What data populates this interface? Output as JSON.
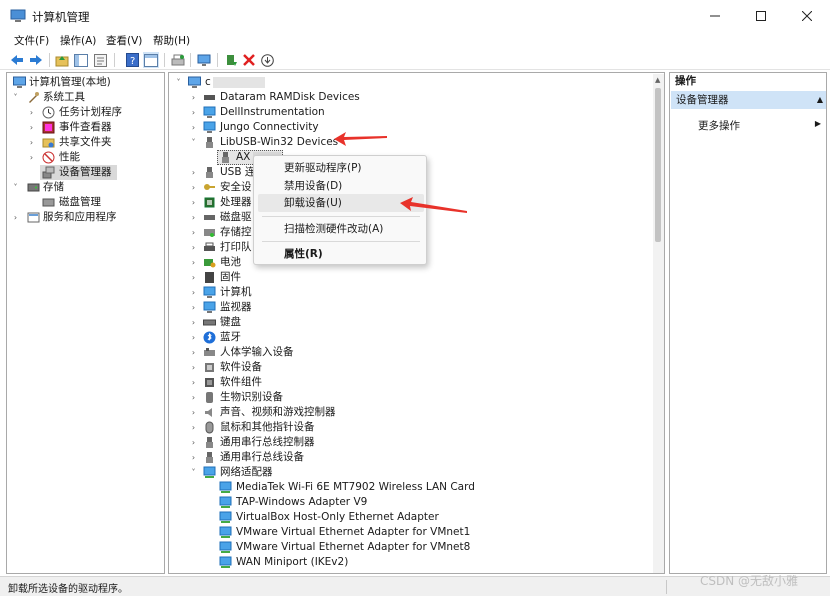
{
  "window": {
    "title": "计算机管理"
  },
  "menu": [
    "文件(F)",
    "操作(A)",
    "查看(V)",
    "帮助(H)"
  ],
  "left_tree": [
    {
      "label": "计算机管理(本地)",
      "icon": "computer-icon"
    },
    {
      "label": "系统工具",
      "icon": "tools-icon"
    },
    {
      "label": "任务计划程序",
      "icon": "clock-icon"
    },
    {
      "label": "事件查看器",
      "icon": "event-viewer-icon"
    },
    {
      "label": "共享文件夹",
      "icon": "shared-folder-icon"
    },
    {
      "label": "性能",
      "icon": "performance-icon"
    },
    {
      "label": "设备管理器",
      "icon": "device-manager-icon"
    },
    {
      "label": "存储",
      "icon": "storage-icon"
    },
    {
      "label": "磁盘管理",
      "icon": "disk-icon"
    },
    {
      "label": "服务和应用程序",
      "icon": "services-icon"
    }
  ],
  "device_tree": {
    "root": "c",
    "items": [
      {
        "label": "Dataram RAMDisk Devices",
        "icon": "ramdisk-icon"
      },
      {
        "label": "DellInstrumentation",
        "icon": "monitor-icon"
      },
      {
        "label": "Jungo Connectivity",
        "icon": "monitor-icon"
      },
      {
        "label": "LibUSB-Win32 Devices",
        "icon": "usb-plug-icon"
      },
      {
        "label": "AX",
        "icon": "usb-plug-icon"
      },
      {
        "label": "USB 连",
        "icon": "usb-plug-icon"
      },
      {
        "label": "安全设",
        "icon": "key-icon"
      },
      {
        "label": "处理器",
        "icon": "processor-icon"
      },
      {
        "label": "磁盘驱",
        "icon": "disk-drive-icon"
      },
      {
        "label": "存储控",
        "icon": "storage-controller-icon"
      },
      {
        "label": "打印队",
        "icon": "printer-icon"
      },
      {
        "label": "电池",
        "icon": "battery-icon"
      },
      {
        "label": "固件",
        "icon": "firmware-icon"
      },
      {
        "label": "计算机",
        "icon": "computer-icon"
      },
      {
        "label": "监视器",
        "icon": "monitor-icon"
      },
      {
        "label": "键盘",
        "icon": "keyboard-icon"
      },
      {
        "label": "蓝牙",
        "icon": "bluetooth-icon"
      },
      {
        "label": "人体学输入设备",
        "icon": "hid-icon"
      },
      {
        "label": "软件设备",
        "icon": "software-device-icon"
      },
      {
        "label": "软件组件",
        "icon": "software-component-icon"
      },
      {
        "label": "生物识别设备",
        "icon": "biometric-icon"
      },
      {
        "label": "声音、视频和游戏控制器",
        "icon": "speaker-icon"
      },
      {
        "label": "鼠标和其他指针设备",
        "icon": "mouse-icon"
      },
      {
        "label": "通用串行总线控制器",
        "icon": "usb-plug-icon"
      },
      {
        "label": "通用串行总线设备",
        "icon": "usb-plug-icon"
      },
      {
        "label": "网络适配器",
        "icon": "network-adapter-icon"
      },
      {
        "label": "MediaTek Wi-Fi 6E MT7902 Wireless LAN Card",
        "icon": "network-adapter-icon"
      },
      {
        "label": "TAP-Windows Adapter V9",
        "icon": "network-adapter-icon"
      },
      {
        "label": "VirtualBox Host-Only Ethernet Adapter",
        "icon": "network-adapter-icon"
      },
      {
        "label": "VMware Virtual Ethernet Adapter for VMnet1",
        "icon": "network-adapter-icon"
      },
      {
        "label": "VMware Virtual Ethernet Adapter for VMnet8",
        "icon": "network-adapter-icon"
      },
      {
        "label": "WAN Miniport (IKEv2)",
        "icon": "network-adapter-icon"
      }
    ]
  },
  "context_menu": {
    "update_driver": "更新驱动程序(P)",
    "disable_device": "禁用设备(D)",
    "uninstall_device": "卸载设备(U)",
    "scan_hardware": "扫描检测硬件改动(A)",
    "properties": "属性(R)"
  },
  "actions": {
    "header": "操作",
    "selected": "设备管理器",
    "more": "更多操作"
  },
  "status": {
    "text": "卸载所选设备的驱动程序。"
  },
  "watermark": "CSDN @无敌小雅",
  "colors": {
    "accent_arrow": "#e8322a",
    "selection": "#cfe3f7",
    "toolbar_blue": "#2b7bd3"
  }
}
